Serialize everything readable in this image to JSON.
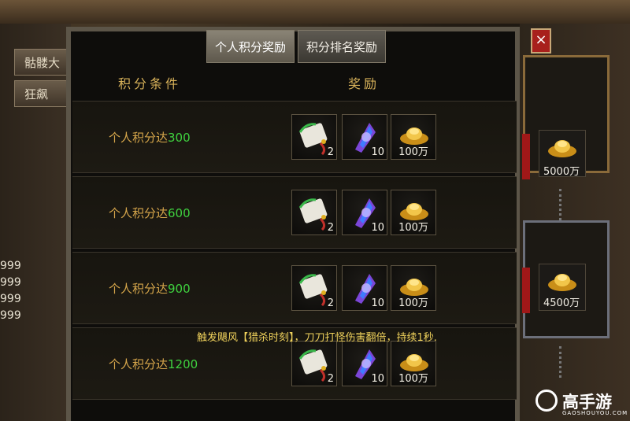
{
  "dialog": {
    "tabs": [
      {
        "label": "个人积分奖励",
        "active": true
      },
      {
        "label": "积分排名奖励",
        "active": false
      }
    ],
    "close_label": "×",
    "headers": {
      "condition": "积分条件",
      "reward": "奖励"
    },
    "rows": [
      {
        "prefix": "个人积分达",
        "points": "300",
        "rewards": [
          {
            "icon": "scroll-icon",
            "qty": "2"
          },
          {
            "icon": "crystal-icon",
            "qty": "10"
          },
          {
            "icon": "gold-ingot-icon",
            "qty": "100万"
          }
        ]
      },
      {
        "prefix": "个人积分达",
        "points": "600",
        "rewards": [
          {
            "icon": "scroll-icon",
            "qty": "2"
          },
          {
            "icon": "crystal-icon",
            "qty": "10"
          },
          {
            "icon": "gold-ingot-icon",
            "qty": "100万"
          }
        ]
      },
      {
        "prefix": "个人积分达",
        "points": "900",
        "rewards": [
          {
            "icon": "scroll-icon",
            "qty": "2"
          },
          {
            "icon": "crystal-icon",
            "qty": "10"
          },
          {
            "icon": "gold-ingot-icon",
            "qty": "100万"
          }
        ]
      },
      {
        "prefix": "个人积分达",
        "points": "1200",
        "rewards": [
          {
            "icon": "scroll-icon",
            "qty": "2"
          },
          {
            "icon": "crystal-icon",
            "qty": "10"
          },
          {
            "icon": "gold-ingot-icon",
            "qty": "100万"
          }
        ]
      }
    ],
    "tooltip": "触发飓风【猎杀时刻】，刀刀打怪伤害翻倍，持续1秒."
  },
  "left_panel": {
    "buttons": [
      "骷髅大",
      "狂飙"
    ],
    "numbers": [
      "999",
      "999",
      "999",
      "999"
    ]
  },
  "right_panel": {
    "rewards": [
      "5000万",
      "4500万"
    ]
  },
  "watermark": {
    "brand": "高手游",
    "domain": "GAOSHOUYOU.COM"
  },
  "colors": {
    "condition_text": "#d6a64b",
    "points_text": "#3fd23f",
    "header_text": "#d8b25a",
    "tooltip_text": "#f0d25c",
    "close_red": "#a8201c"
  }
}
